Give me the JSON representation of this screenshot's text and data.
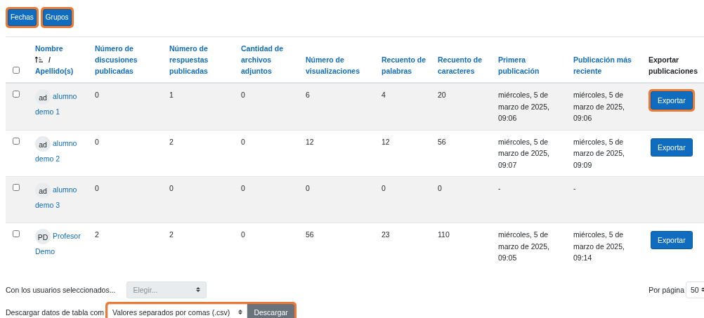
{
  "top_buttons": [
    {
      "label": "Fechas",
      "highlighted": true
    },
    {
      "label": "Grupos",
      "highlighted": true
    }
  ],
  "table": {
    "select_all_checked": false,
    "columns": [
      {
        "kind": "link",
        "label": "Nombre",
        "sorted_ascending": true,
        "separator": "/",
        "second_label": "Apellido(s)"
      },
      {
        "kind": "link",
        "label": "Número de discusiones publicadas"
      },
      {
        "kind": "link",
        "label": "Número de respuestas publicadas"
      },
      {
        "kind": "link",
        "label": "Cantidad de archivos adjuntos"
      },
      {
        "kind": "link",
        "label": "Número de visualizaciones"
      },
      {
        "kind": "link",
        "label": "Recuento de palabras"
      },
      {
        "kind": "link",
        "label": "Recuento de caracteres"
      },
      {
        "kind": "link",
        "label": "Primera publicación"
      },
      {
        "kind": "link",
        "label": "Publicación más reciente"
      },
      {
        "kind": "plain",
        "label": "Exportar publicaciones"
      }
    ],
    "rows": [
      {
        "checked": false,
        "initials": "ad",
        "cells": [
          "alumno demo 1",
          "0",
          "1",
          "0",
          "6",
          "4",
          "20",
          "miércoles, 5 de marzo de 2025, 09:06",
          "miércoles, 5 de marzo de 2025, 09:06"
        ],
        "action": {
          "label": "Exportar",
          "highlighted": true
        }
      },
      {
        "checked": false,
        "initials": "ad",
        "cells": [
          "alumno demo 2",
          "0",
          "2",
          "0",
          "12",
          "12",
          "56",
          "miércoles, 5 de marzo de 2025, 09:07",
          "miércoles, 5 de marzo de 2025, 09:09"
        ],
        "action": {
          "label": "Exportar",
          "highlighted": false
        }
      },
      {
        "checked": false,
        "initials": "ad",
        "cells": [
          "alumno demo 3",
          "0",
          "0",
          "0",
          "0",
          "0",
          "0",
          "-",
          "-"
        ]
      },
      {
        "checked": false,
        "initials": "PD",
        "cells": [
          "Profesor Demo",
          "2",
          "2",
          "0",
          "56",
          "23",
          "110",
          "miércoles, 5 de marzo de 2025, 09:05",
          "miércoles, 5 de marzo de 2025, 09:14"
        ],
        "action": {
          "label": "Exportar",
          "highlighted": false
        }
      }
    ]
  },
  "bulk": {
    "label": "Con los usuarios seleccionados...",
    "select": {
      "value": "Elegir...",
      "disabled": true
    }
  },
  "per_page": {
    "label": "Por página",
    "value": "50"
  },
  "download": {
    "label": "Descargar datos de tabla com",
    "format": "Valores separados por comas (.csv)",
    "button": "Descargar",
    "highlighted": true
  }
}
